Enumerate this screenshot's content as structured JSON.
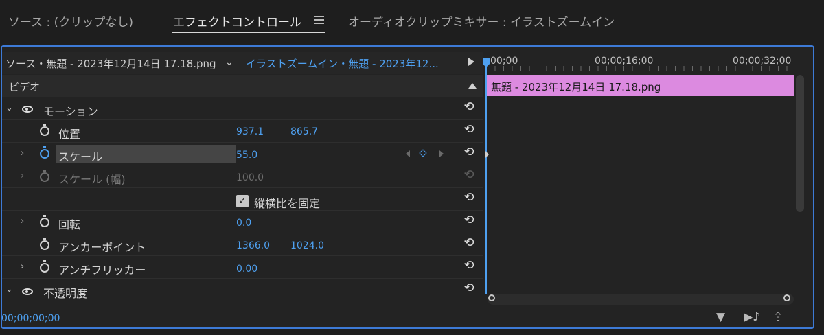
{
  "tabs": [
    {
      "label": "ソース : (クリップなし)"
    },
    {
      "label": "エフェクトコントロール"
    },
    {
      "label": "オーディオクリップミキサー : イラストズームイン"
    }
  ],
  "source_bar": {
    "left": "ソース・無題 - 2023年12月14日 17.18.png",
    "right": "イラストズームイン・無題 - 2023年12..."
  },
  "section": {
    "video": "ビデオ"
  },
  "effects": {
    "motion": "モーション",
    "position": {
      "label": "位置",
      "x": "937.1",
      "y": "865.7"
    },
    "scale": {
      "label": "スケール",
      "value": "55.0"
    },
    "scale_width": {
      "label": "スケール (幅)",
      "value": "100.0"
    },
    "uniform_scale": {
      "label": "縦横比を固定",
      "checked": true
    },
    "rotation": {
      "label": "回転",
      "value": "0.0"
    },
    "anchor": {
      "label": "アンカーポイント",
      "x": "1366.0",
      "y": "1024.0"
    },
    "flicker": {
      "label": "アンチフリッカー",
      "value": "0.00"
    },
    "opacity": "不透明度"
  },
  "timeline": {
    "ruler": [
      "00;00",
      "00;00;16;00",
      "00;00;32;00"
    ],
    "clip_label": "無題 - 2023年12月14日 17.18.png"
  },
  "footer": {
    "timecode": "00;00;00;00"
  },
  "colors": {
    "accent": "#4ea0f0",
    "clip": "#dc8ae0",
    "panel_border": "#3d7ad6"
  }
}
